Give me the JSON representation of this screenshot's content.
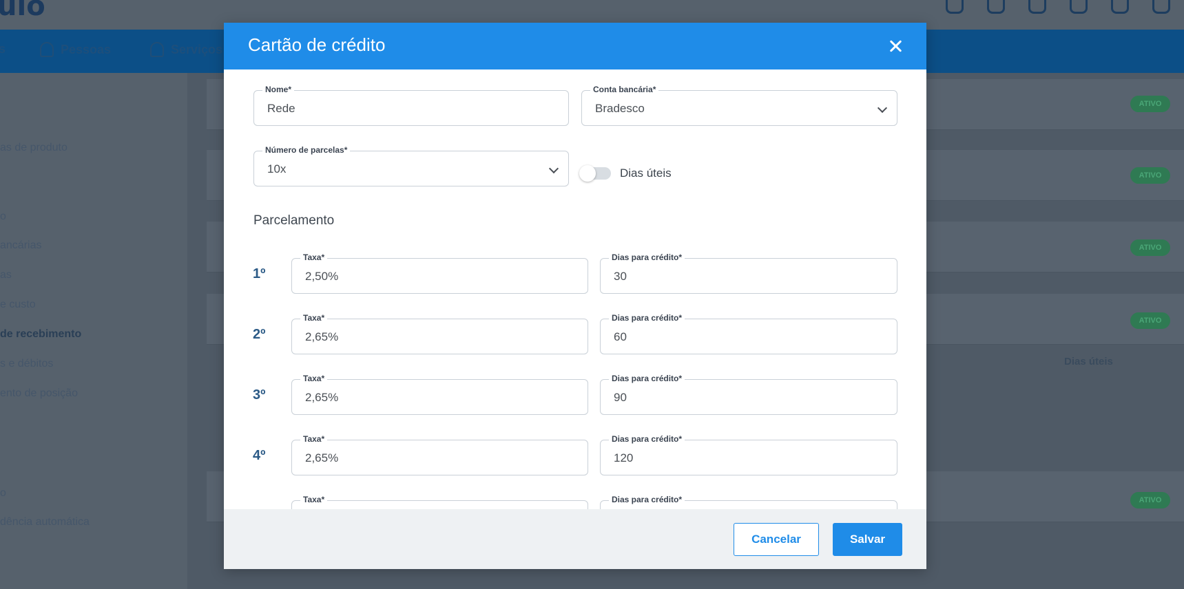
{
  "background": {
    "logo": "uio",
    "nav": [
      {
        "label": "s"
      },
      {
        "label": "Pessoas"
      },
      {
        "label": "Serviços"
      }
    ],
    "sidebar": [
      "as de produto",
      "o",
      "ancárias",
      "as",
      "e custo",
      "de recebimento",
      "s e débitos",
      "ento de posição",
      "o",
      "dência automática"
    ],
    "badge_label": "ATIVO",
    "column_header": "Dias úteis",
    "badge_color": "#2f7a53"
  },
  "modal": {
    "title": "Cartão de crédito",
    "accent_color": "#1f8ce8",
    "nome": {
      "label": "Nome*",
      "value": "Rede"
    },
    "conta_bancaria": {
      "label": "Conta bancária*",
      "value": "Bradesco"
    },
    "numero_parcelas": {
      "label": "Número de parcelas*",
      "value": "10x"
    },
    "dias_uteis": {
      "label": "Dias úteis",
      "checked": false
    },
    "section_title": "Parcelamento",
    "installments": [
      {
        "ordinal": "1º",
        "taxa_label": "Taxa*",
        "taxa": "2,50%",
        "dias_label": "Dias para crédito*",
        "dias": "30"
      },
      {
        "ordinal": "2º",
        "taxa_label": "Taxa*",
        "taxa": "2,65%",
        "dias_label": "Dias para crédito*",
        "dias": "60"
      },
      {
        "ordinal": "3º",
        "taxa_label": "Taxa*",
        "taxa": "2,65%",
        "dias_label": "Dias para crédito*",
        "dias": "90"
      },
      {
        "ordinal": "4º",
        "taxa_label": "Taxa*",
        "taxa": "2,65%",
        "dias_label": "Dias para crédito*",
        "dias": "120"
      },
      {
        "ordinal": "",
        "taxa_label": "Taxa*",
        "taxa": "",
        "dias_label": "Dias para crédito*",
        "dias": ""
      }
    ],
    "cancel_label": "Cancelar",
    "save_label": "Salvar"
  }
}
